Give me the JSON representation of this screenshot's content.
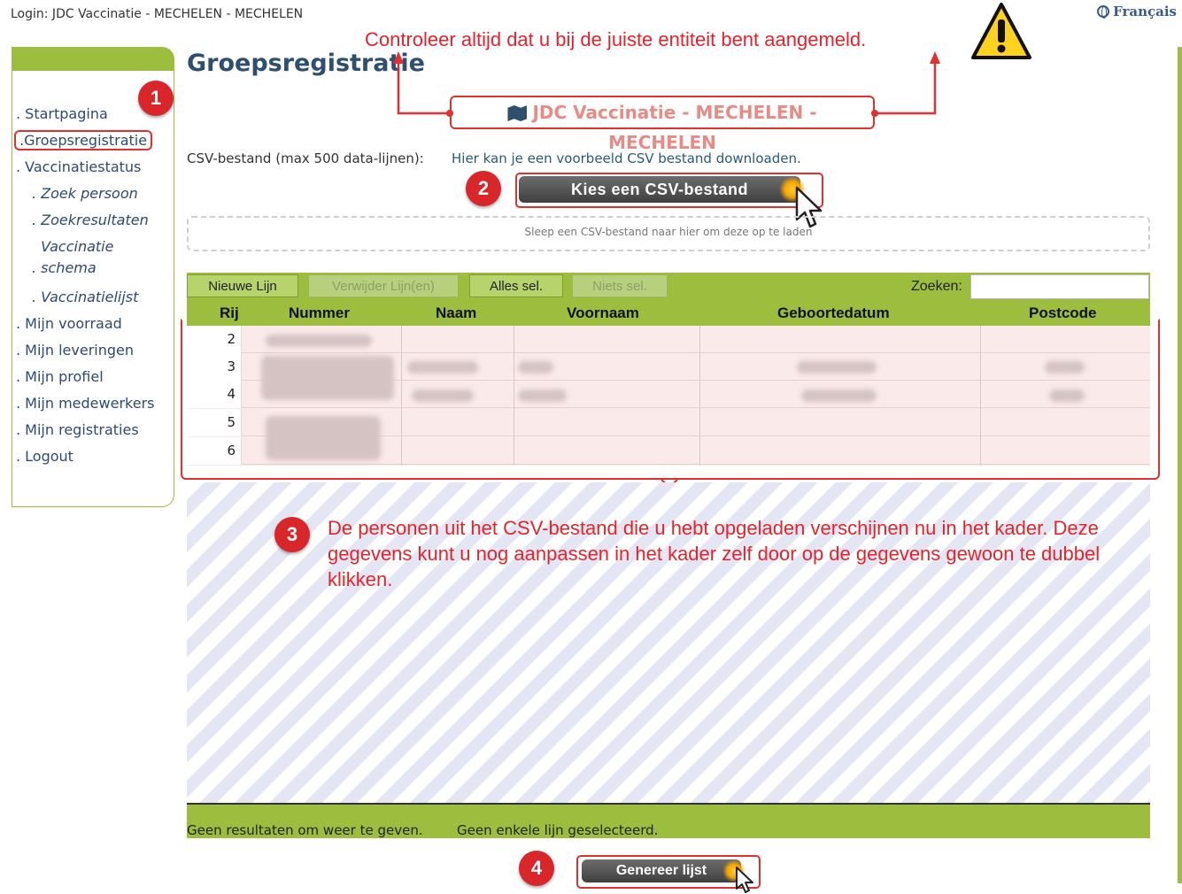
{
  "header": {
    "login_text": "Login: JDC Vaccinatie - MECHELEN - MECHELEN",
    "language_link": "Français"
  },
  "sidebar": {
    "items": [
      {
        "label": "Startpagina"
      },
      {
        "label": "Groepsregistratie",
        "active": true
      },
      {
        "label": "Vaccinatiestatus"
      },
      {
        "label": "Zoek persoon"
      },
      {
        "label": "Zoekresultaten"
      },
      {
        "label": "Vaccinatie schema"
      },
      {
        "label": "Vaccinatielijst"
      },
      {
        "label": "Mijn voorraad"
      },
      {
        "label": "Mijn leveringen"
      },
      {
        "label": "Mijn profiel"
      },
      {
        "label": "Mijn medewerkers"
      },
      {
        "label": "Mijn registraties"
      },
      {
        "label": "Logout"
      }
    ]
  },
  "main": {
    "title": "Groepsregistratie",
    "entity": "JDC Vaccinatie - MECHELEN - MECHELEN",
    "csv_label": "CSV-bestand (max 500 data-lijnen):",
    "csv_example_link": "Hier kan je een voorbeeld CSV bestand downloaden.",
    "choose_csv_button": "Kies een CSV-bestand",
    "dropzone_text": "Sleep een CSV-bestand naar hier om deze op te laden",
    "toolbar": {
      "new_line": "Nieuwe Lijn",
      "delete_lines": "Verwijder Lijn(en)",
      "select_all": "Alles sel.",
      "select_none": "Niets sel.",
      "search_label": "Zoeken:",
      "search_value": ""
    },
    "table": {
      "columns": [
        "Rij",
        "Nummer",
        "Naam",
        "Voornaam",
        "Geboortedatum",
        "Postcode"
      ],
      "rows": [
        "2",
        "3",
        "4",
        "5",
        "6"
      ]
    },
    "footer": {
      "no_results": "Geen resultaten om weer te geven.",
      "no_selection": "Geen enkele lijn geselecteerd."
    },
    "generate_button": "Genereer lijst"
  },
  "annotations": {
    "warning": "Controleer altijd dat u bij de juiste entiteit bent aangemeld.",
    "badges": [
      "1",
      "2",
      "3",
      "4"
    ],
    "explanation": "De personen uit het CSV-bestand die u hebt opgeladen verschijnen nu in het kader. Deze gegevens kunt u nog aanpassen in het kader zelf door op de gegevens gewoon te dubbel klikken.",
    "accent_color": "#e8222a",
    "brand_green": "#9dbd3e"
  }
}
